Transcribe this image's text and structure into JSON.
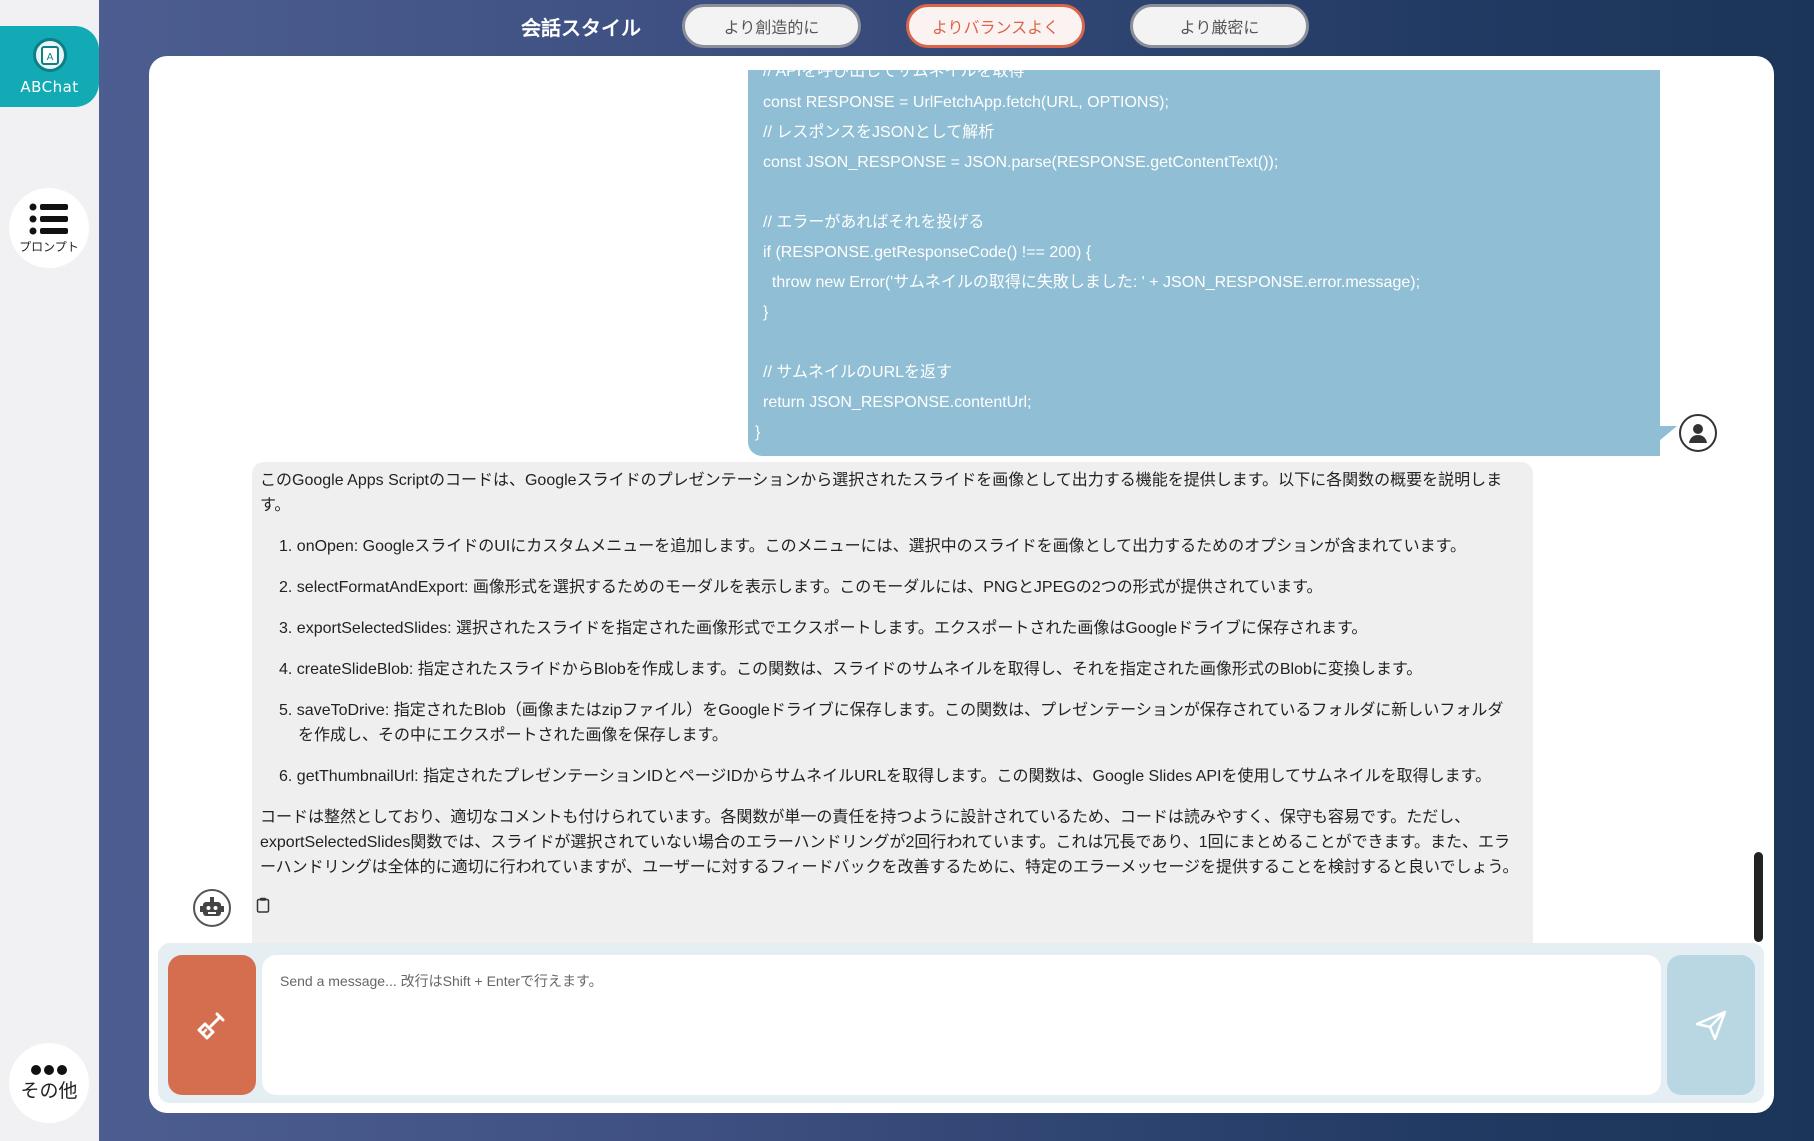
{
  "app": {
    "name": "ABChat"
  },
  "sidebar": {
    "prompt_label": "プロンプト",
    "more_label": "その他"
  },
  "style_selector": {
    "title": "会話スタイル",
    "options": [
      "より創造的に",
      "よりバランスよく",
      "より厳密に"
    ],
    "selected": "よりバランスよく"
  },
  "code_message": {
    "lines": [
      "// APIを呼び出してサムネイルを取得",
      "const RESPONSE = UrlFetchApp.fetch(URL, OPTIONS);",
      "// レスポンスをJSONとして解析",
      "const JSON_RESPONSE = JSON.parse(RESPONSE.getContentText());",
      "",
      "// エラーがあればそれを投げる",
      "if (RESPONSE.getResponseCode() !== 200) {",
      "  throw new Error('サムネイルの取得に失敗しました: ' + JSON_RESPONSE.error.message);",
      "}",
      "",
      "// サムネイルのURLを返す",
      "return JSON_RESPONSE.contentUrl;",
      "}"
    ]
  },
  "answer": {
    "intro": "このGoogle Apps Scriptのコードは、Googleスライドのプレゼンテーションから選択されたスライドを画像として出力する機能を提供します。以下に各関数の概要を説明しま",
    "intro_cont": "す。",
    "items": [
      "1. onOpen: GoogleスライドのUIにカスタムメニューを追加します。このメニューには、選択中のスライドを画像として出力するためのオプションが含まれています。",
      "2. selectFormatAndExport: 画像形式を選択するためのモーダルを表示します。このモーダルには、PNGとJPEGの2つの形式が提供されています。",
      "3. exportSelectedSlides: 選択されたスライドを指定された画像形式でエクスポートします。エクスポートされた画像はGoogleドライブに保存されます。",
      "4. createSlideBlob: 指定されたスライドからBlobを作成します。この関数は、スライドのサムネイルを取得し、それを指定された画像形式のBlobに変換します。",
      "5. saveToDrive: 指定されたBlob（画像またはzipファイル）をGoogleドライブに保存します。この関数は、プレゼンテーションが保存されているフォルダに新しいフォルダ",
      "を作成し、その中にエクスポートされた画像を保存します。",
      "6. getThumbnailUrl: 指定されたプレゼンテーションIDとページIDからサムネイルURLを取得します。この関数は、Google Slides APIを使用してサムネイルを取得します。"
    ],
    "summary": [
      "コードは整然としており、適切なコメントも付けられています。各関数が単一の責任を持つように設計されているため、コードは読みやすく、保守も容易です。ただし、",
      "exportSelectedSlides関数では、スライドが選択されていない場合のエラーハンドリングが2回行われています。これは冗長であり、1回にまとめることができます。また、エラ",
      "ーハンドリングは全体的に適切に行われていますが、ユーザーに対するフィードバックを改善するために、特定のエラーメッセージを提供することを検討すると良いでしょう。"
    ]
  },
  "input": {
    "placeholder": "Send a message... 改行はShift + Enterで行えます。",
    "value": ""
  },
  "colors": {
    "accent": "#12aab4",
    "user_bubble": "#90bed4",
    "clear_button": "#d56d4f",
    "selected_style": "#d9664a"
  }
}
